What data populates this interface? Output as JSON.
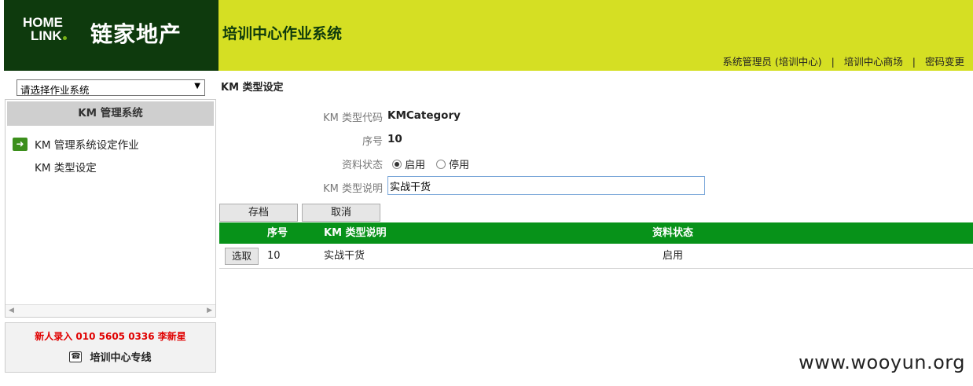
{
  "brand": {
    "logo_line1": "HOME",
    "logo_line2": "LINK",
    "logo_cn": "链家地产",
    "header_bg": "#0e3a0d",
    "accent": "#d5df23"
  },
  "header": {
    "app_title": "培训中心作业系统",
    "links": [
      "系统管理员 (培训中心)",
      "培训中心商场",
      "密码变更"
    ],
    "separator": "|"
  },
  "sidebar": {
    "system_select": "请选择作业系统",
    "panel_title": "KM 管理系统",
    "group_label": "KM 管理系统设定作业",
    "group_icon": "arrow-right-icon",
    "items": [
      {
        "label": "KM 类型设定"
      }
    ],
    "hotline_text": "新人录入 010 5605 0336 李新星",
    "hotline_label": "培训中心专线",
    "hotline_icon": "phone-icon"
  },
  "form": {
    "section_title": "KM 类型设定",
    "code_label": "KM 类型代码",
    "code_value": "KMCategory",
    "seq_label": "序号",
    "seq_value": "10",
    "status_label": "资料状态",
    "status_options": [
      "启用",
      "停用"
    ],
    "status_selected": "启用",
    "desc_label": "KM 类型说明",
    "desc_value": "实战干货",
    "save_label": "存档",
    "cancel_label": "取消"
  },
  "table": {
    "header_color": "#079219",
    "columns": [
      "序号",
      "KM 类型说明",
      "资料状态"
    ],
    "rows": [
      {
        "action": "选取",
        "seq": "10",
        "desc": "实战干货",
        "status": "启用"
      }
    ]
  },
  "watermark": "www.wooyun.org"
}
